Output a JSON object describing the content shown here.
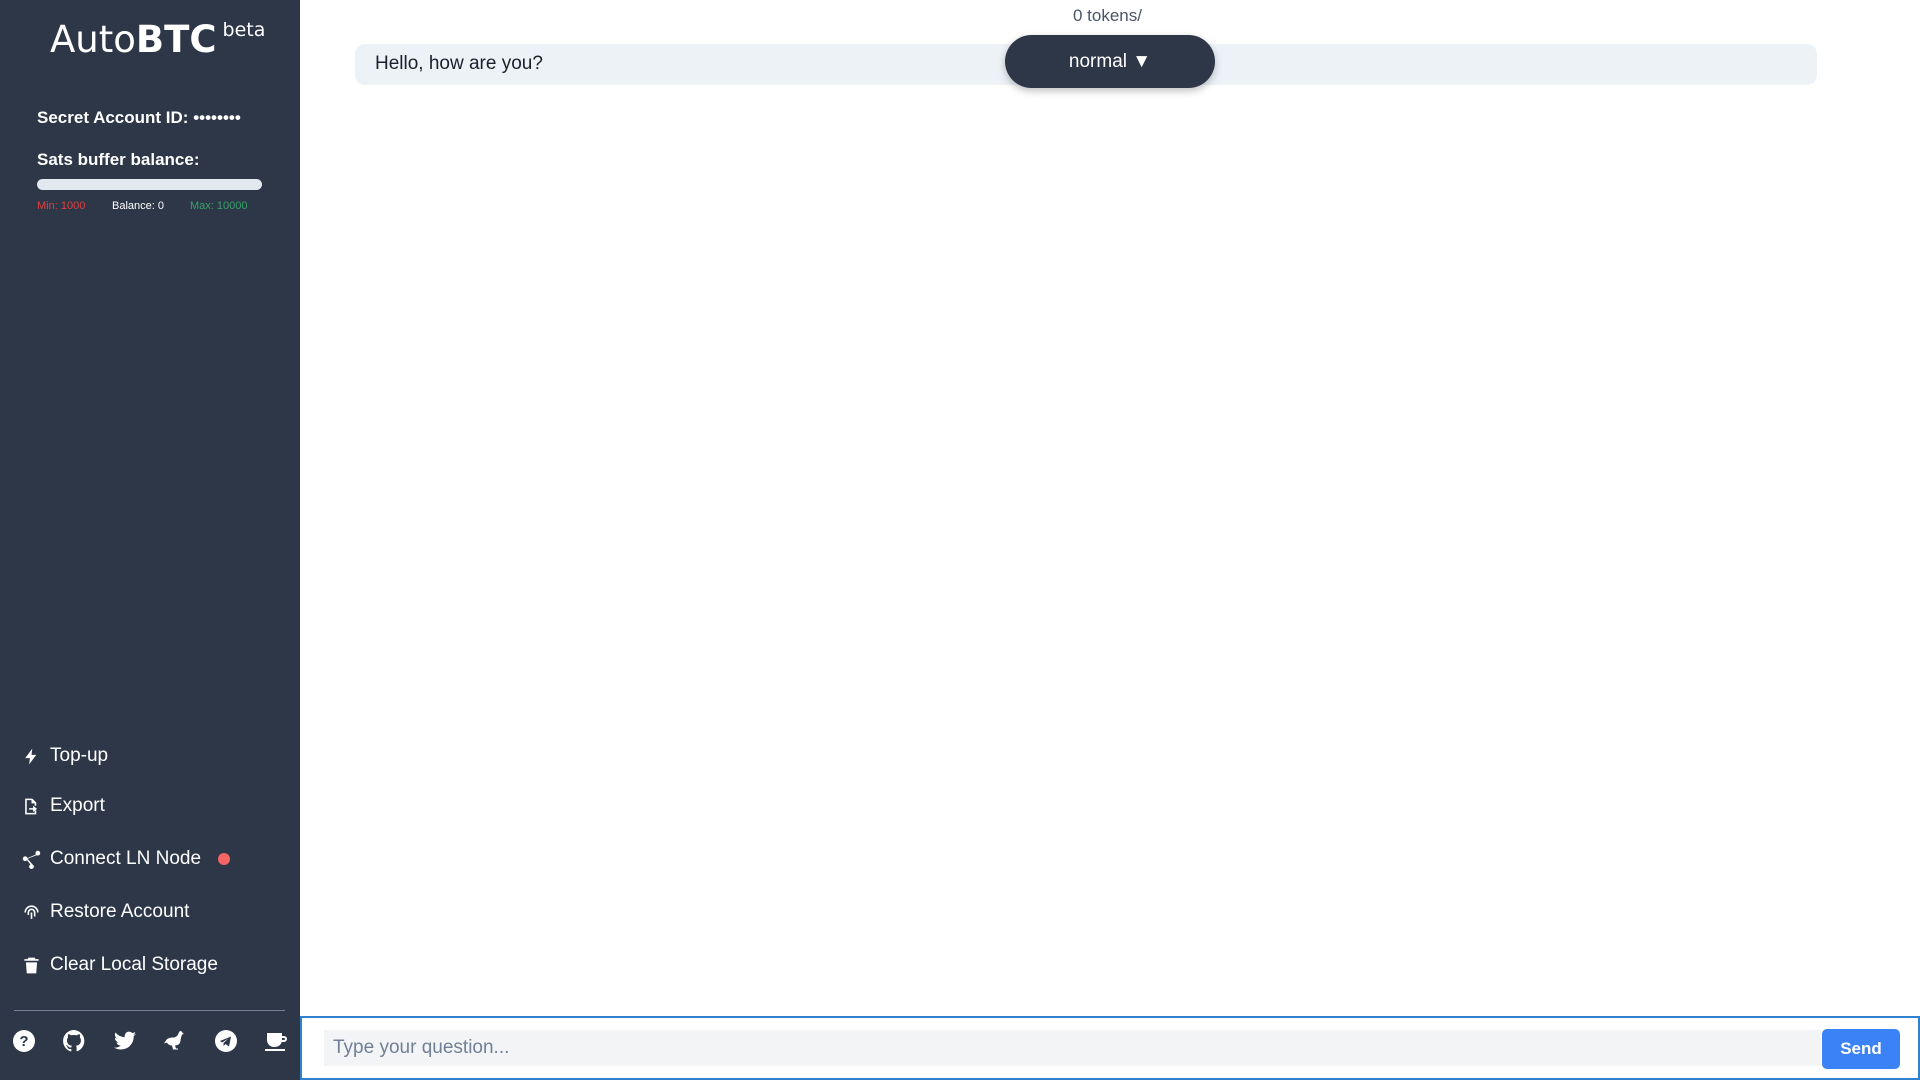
{
  "brand": {
    "prefix": "Auto",
    "bold": "BTC",
    "badge": "beta"
  },
  "account": {
    "label": "Secret Account ID:",
    "value": "••••••••"
  },
  "balance": {
    "label": "Sats buffer balance:",
    "min_label": "Min: 1000",
    "current_label": "Balance: 0",
    "max_label": "Max: 10000",
    "fill_fraction": 0,
    "colors": {
      "min": "#e53e3e",
      "max": "#38a169",
      "track": "#e2e8f0"
    }
  },
  "menu": [
    {
      "label": "Top-up",
      "icon": "bolt-icon"
    },
    {
      "label": "Export",
      "icon": "file-export-icon"
    },
    {
      "label": "Connect LN Node",
      "icon": "network-icon",
      "status": "disconnected",
      "status_color": "#f56565"
    },
    {
      "label": "Restore Account",
      "icon": "fingerprint-icon"
    },
    {
      "label": "Clear Local Storage",
      "icon": "trash-icon"
    }
  ],
  "social": [
    "help-icon",
    "github-icon",
    "twitter-icon",
    "nostr-ostrich-icon",
    "telegram-icon",
    "coffee-icon"
  ],
  "chat": {
    "tokens": "0 tokens/",
    "mode": "normal",
    "mode_arrow": "▼",
    "messages": [
      {
        "text": "Hello, how are you?"
      }
    ]
  },
  "input": {
    "placeholder": "Type your question...",
    "value": "",
    "send_label": "Send"
  },
  "theme": {
    "sidebar_bg": "#2d3748",
    "accent": "#3b82f6",
    "focus_border": "#3182ce"
  }
}
